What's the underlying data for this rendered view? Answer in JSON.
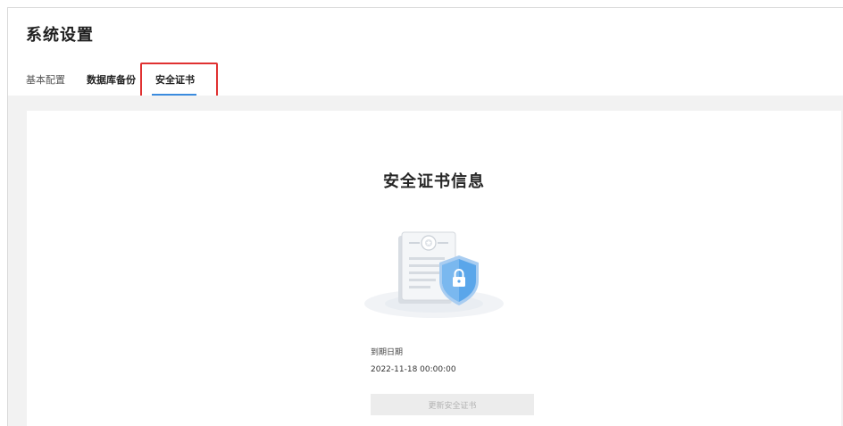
{
  "header": {
    "title": "系统设置"
  },
  "tabs": [
    {
      "label": "基本配置",
      "active": false
    },
    {
      "label": "数据库备份",
      "active": false
    },
    {
      "label": "安全证书",
      "active": true
    }
  ],
  "certificate": {
    "title": "安全证书信息",
    "illustration_icon": "certificate-shield-lock-icon",
    "expiry_label": "到期日期",
    "expiry_value": "2022-11-18 00:00:00",
    "update_button_label": "更新安全证书",
    "update_button_enabled": false
  },
  "colors": {
    "accent": "#3b8bde",
    "highlight": "#e03131",
    "shield": "#5aa6ea",
    "background": "#f2f2f2"
  }
}
